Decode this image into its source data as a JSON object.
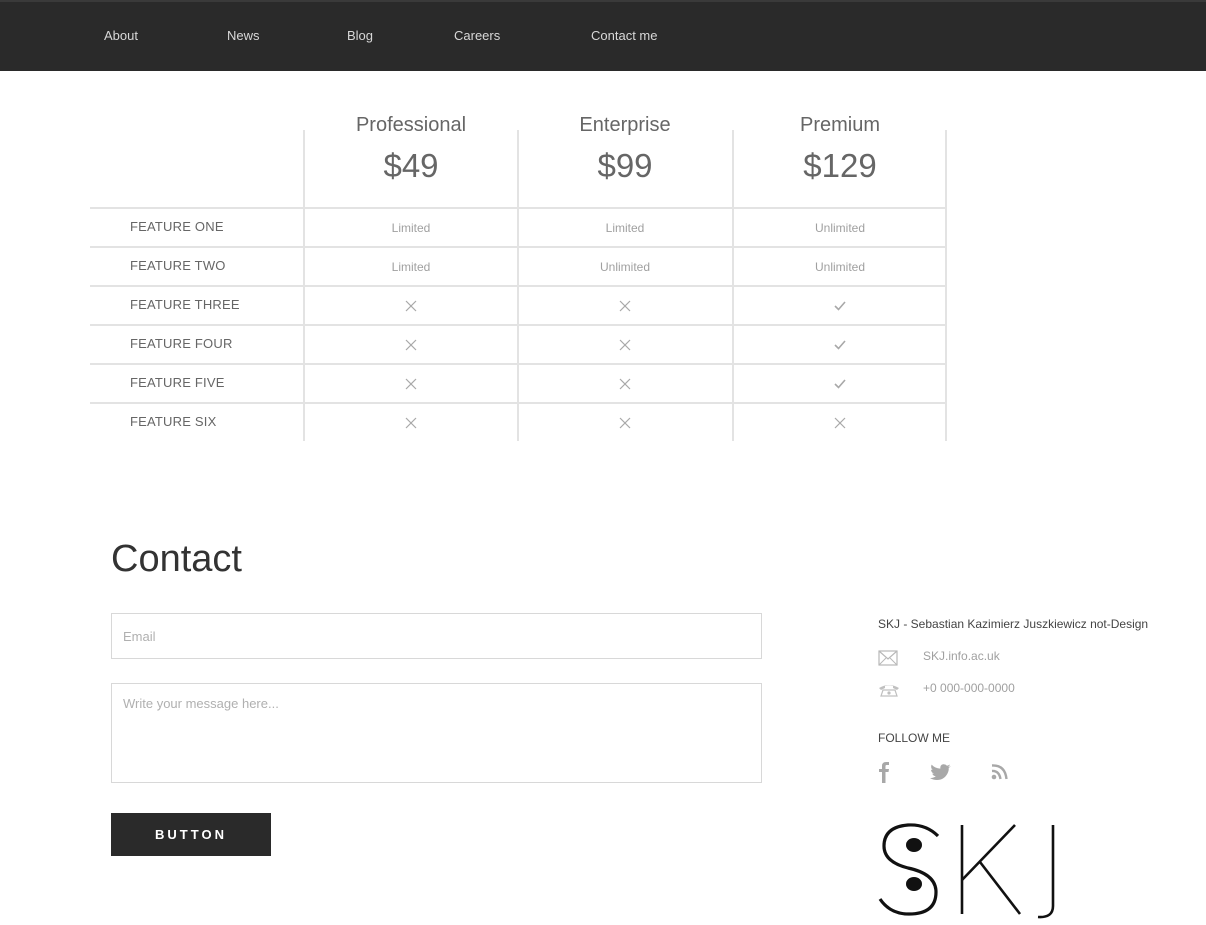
{
  "nav": {
    "items": [
      {
        "label": "About"
      },
      {
        "label": "News"
      },
      {
        "label": "Blog"
      },
      {
        "label": "Careers"
      },
      {
        "label": "Contact me"
      }
    ]
  },
  "pricing": {
    "plans": [
      {
        "name": "Professional",
        "price": "$49"
      },
      {
        "name": "Enterprise",
        "price": "$99"
      },
      {
        "name": "Premium",
        "price": "$129"
      }
    ],
    "features": [
      {
        "label": "FEATURE ONE",
        "values": [
          "Limited",
          "Limited",
          "Unlimited"
        ]
      },
      {
        "label": "FEATURE TWO",
        "values": [
          "Limited",
          "Unlimited",
          "Unlimited"
        ]
      },
      {
        "label": "FEATURE THREE",
        "values": [
          "x-icon",
          "x-icon",
          "check-icon"
        ]
      },
      {
        "label": "FEATURE FOUR",
        "values": [
          "x-icon",
          "x-icon",
          "check-icon"
        ]
      },
      {
        "label": "FEATURE FIVE",
        "values": [
          "x-icon",
          "x-icon",
          "check-icon"
        ]
      },
      {
        "label": "FEATURE SIX",
        "values": [
          "x-icon",
          "x-icon",
          "x-icon"
        ]
      }
    ]
  },
  "contact": {
    "title": "Contact",
    "email_placeholder": "Email",
    "message_placeholder": "Write your message here...",
    "button_label": "BUTTON"
  },
  "sidebar": {
    "company": "SKJ - Sebastian Kazimierz Juszkiewicz not-Design",
    "email": "SKJ.info.ac.uk",
    "phone": "+0 000-000-0000",
    "follow_label": "FOLLOW ME",
    "social": [
      "facebook-icon",
      "twitter-icon",
      "rss-icon"
    ],
    "logo_text": "SKJ"
  },
  "colors": {
    "nav_bg": "#2a2a2a",
    "button_bg": "#2a2a2a",
    "icon_gray": "#a8a8a8"
  }
}
